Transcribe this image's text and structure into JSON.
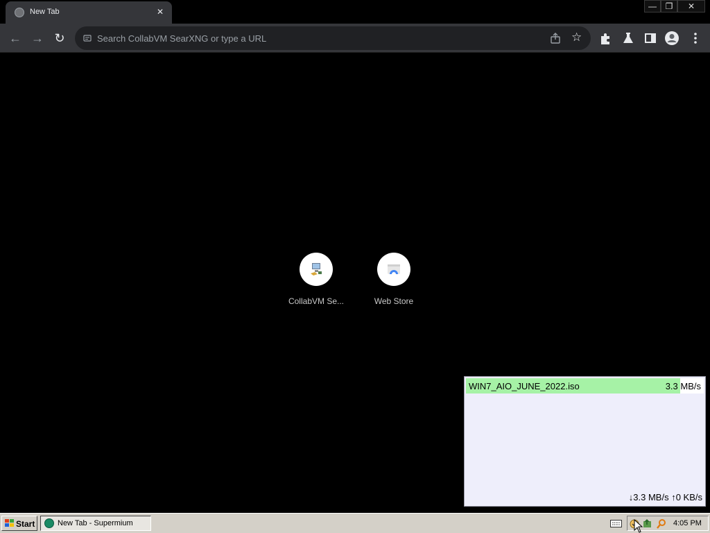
{
  "browser": {
    "tab": {
      "title": "New Tab",
      "close_glyph": "✕",
      "favicon": "globe-icon"
    },
    "window_controls": {
      "minimize": "—",
      "maximize": "❐",
      "close": "✕"
    },
    "toolbar": {
      "back_glyph": "←",
      "forward_glyph": "→",
      "reload_glyph": "↻",
      "omnibox_placeholder": "Search CollabVM SearXNG or type a URL",
      "omnibox_value": "",
      "star_glyph": "☆",
      "icons": [
        "back-icon",
        "forward-icon",
        "reload-icon",
        "search-engine-icon",
        "share-icon",
        "star-icon",
        "extensions-icon",
        "labs-icon",
        "side-panel-icon",
        "profile-icon",
        "menu-icon"
      ]
    }
  },
  "shortcuts": [
    {
      "label": "CollabVM Se...",
      "icon": "collabvm-icon"
    },
    {
      "label": "Web Store",
      "icon": "web-store-icon"
    }
  ],
  "download": {
    "filename": "WIN7_AIO_JUNE_2022.iso",
    "speed": "3.3 MB/s",
    "progress": 0.9,
    "total": "↓3.3 MB/s ↑0 KB/s"
  },
  "taskbar": {
    "start_label": "Start",
    "task_label": "New Tab - Supermium",
    "clock": "4:05 PM",
    "tray_icons": [
      "keyboard-icon",
      "network-icon",
      "update-icon",
      "search-tray-icon"
    ]
  },
  "colors": {
    "tab_bg": "#35363a",
    "omnibox_bg": "#202124",
    "download_bar": "#a6f2a6",
    "download_panel": "#eeeefb",
    "taskbar": "#d4d0c8"
  }
}
